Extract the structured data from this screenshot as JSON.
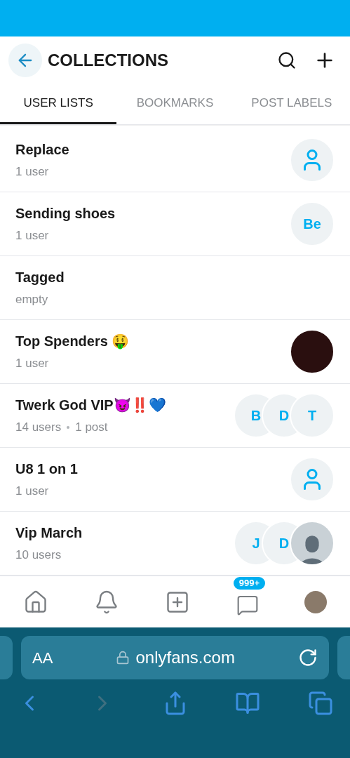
{
  "header": {
    "title": "COLLECTIONS"
  },
  "tabs": [
    {
      "label": "USER LISTS",
      "selected": true
    },
    {
      "label": "BOOKMARKS",
      "selected": false
    },
    {
      "label": "POST LABELS",
      "selected": false
    }
  ],
  "lists": [
    {
      "name": "Replace",
      "meta": [
        "1 user"
      ],
      "avatars": [
        {
          "kind": "icon"
        }
      ]
    },
    {
      "name": "Sending shoes",
      "meta": [
        "1 user"
      ],
      "avatars": [
        {
          "kind": "initials",
          "text": "Be"
        }
      ]
    },
    {
      "name": "Tagged",
      "meta": [
        "empty"
      ]
    },
    {
      "name": "Top Spenders 🤑",
      "meta": [
        "1 user"
      ],
      "avatars": [
        {
          "kind": "photo"
        }
      ]
    },
    {
      "name": "Twerk God VIP😈‼️💙",
      "meta": [
        "14 users",
        "1 post"
      ],
      "avatars": [
        {
          "kind": "initials",
          "text": "B"
        },
        {
          "kind": "initials",
          "text": "D"
        },
        {
          "kind": "initials",
          "text": "T"
        }
      ]
    },
    {
      "name": "U8 1 on 1",
      "meta": [
        "1 user"
      ],
      "avatars": [
        {
          "kind": "icon"
        }
      ]
    },
    {
      "name": "Vip March",
      "meta": [
        "10 users"
      ],
      "avatars": [
        {
          "kind": "initials",
          "text": "J"
        },
        {
          "kind": "initials",
          "text": "D"
        },
        {
          "kind": "silhouette"
        }
      ]
    }
  ],
  "bottom_nav": {
    "messages_badge": "999+"
  },
  "browser": {
    "text_size": "AA",
    "url": "onlyfans.com"
  }
}
